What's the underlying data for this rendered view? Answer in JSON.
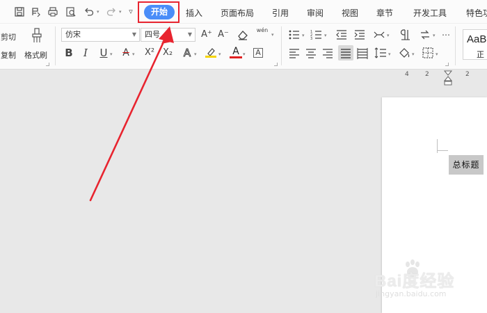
{
  "quick_access": {
    "icons": [
      "save-icon",
      "save-as-icon",
      "print-icon",
      "print-preview-icon",
      "undo-icon",
      "redo-icon",
      "customize-icon"
    ]
  },
  "tabs": [
    {
      "label": "开始",
      "active": true
    },
    {
      "label": "插入"
    },
    {
      "label": "页面布局"
    },
    {
      "label": "引用"
    },
    {
      "label": "审阅"
    },
    {
      "label": "视图"
    },
    {
      "label": "章节"
    },
    {
      "label": "开发工具"
    },
    {
      "label": "特色功"
    }
  ],
  "ribbon": {
    "cut_label": "剪切",
    "copy_label": "复制",
    "format_painter_label": "格式刷",
    "font_family": "仿宋",
    "font_size": "四号",
    "bold_glyph": "B",
    "italic_glyph": "I",
    "underline_glyph": "U",
    "strike_glyph": "A",
    "superscript_glyph": "X²",
    "subscript_glyph": "X₂",
    "text_effect_glyph": "A",
    "font_color_glyph": "A",
    "char_border_glyph": "A",
    "grow_font_glyph": "A⁺",
    "shrink_font_glyph": "A⁻",
    "pinyin_glyph": "wén"
  },
  "style_gallery": {
    "preview": "AaB",
    "name": "正"
  },
  "ruler": {
    "numbers": [
      "4",
      "2",
      "2"
    ]
  },
  "document": {
    "title": "总标题"
  },
  "watermark": {
    "main": "Bai度经验",
    "sub": "jingyan.baidu.com"
  },
  "colors": {
    "active_tab": "#4a8df8",
    "highlight_box": "#e8242f",
    "annotation_arrow": "#e8242f",
    "highlight_color_bar": "#f5d400",
    "font_color_bar": "#e02020"
  }
}
